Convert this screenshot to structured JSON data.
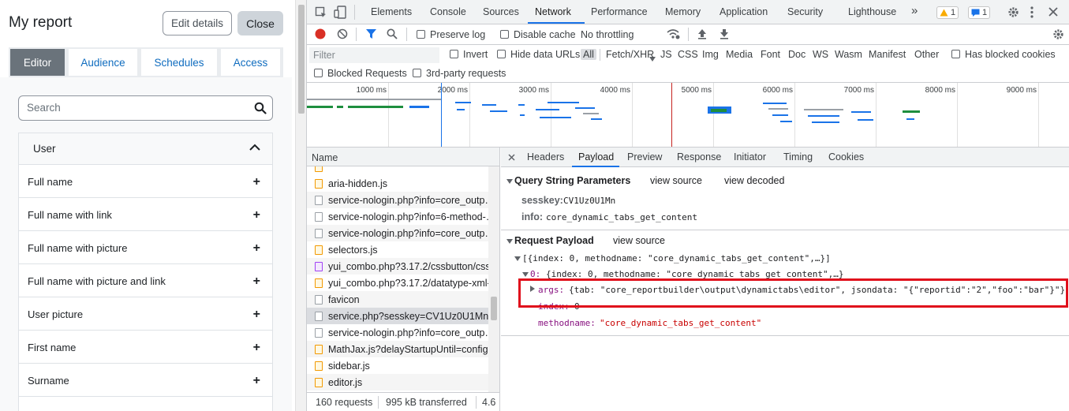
{
  "moodle": {
    "title": "My report",
    "edit_label": "Edit details",
    "close_label": "Close",
    "tabs": [
      "Editor",
      "Audience",
      "Schedules",
      "Access"
    ],
    "search_placeholder": "Search",
    "section_title": "User",
    "columns": [
      "Full name",
      "Full name with link",
      "Full name with picture",
      "Full name with picture and link",
      "User picture",
      "First name",
      "Surname"
    ],
    "plus": "+"
  },
  "devtools": {
    "tabs": [
      "Elements",
      "Console",
      "Sources",
      "Network",
      "Performance",
      "Memory",
      "Application",
      "Security",
      "Lighthouse"
    ],
    "more": "»",
    "warn_count": "1",
    "msg_count": "1",
    "toolbar": {
      "preserve_log": "Preserve log",
      "disable_cache": "Disable cache",
      "throttling": "No throttling"
    },
    "filter": {
      "placeholder": "Filter",
      "invert": "Invert",
      "hide_data_urls": "Hide data URLs",
      "types": [
        "All",
        "Fetch/XHR",
        "JS",
        "CSS",
        "Img",
        "Media",
        "Font",
        "Doc",
        "WS",
        "Wasm",
        "Manifest",
        "Other"
      ],
      "has_blocked_cookies": "Has blocked cookies",
      "blocked_requests": "Blocked Requests",
      "third_party": "3rd-party requests"
    },
    "timeline_labels": [
      "1000 ms",
      "2000 ms",
      "3000 ms",
      "4000 ms",
      "5000 ms",
      "6000 ms",
      "7000 ms",
      "8000 ms",
      "9000 ms"
    ],
    "name_header": "Name",
    "requests": [
      {
        "name": "aria-hidden.js",
        "type": "js"
      },
      {
        "name": "service-nologin.php?info=core_outp…",
        "type": "doc"
      },
      {
        "name": "service-nologin.php?info=6-method-…",
        "type": "doc"
      },
      {
        "name": "service-nologin.php?info=core_outp…",
        "type": "doc"
      },
      {
        "name": "selectors.js",
        "type": "js"
      },
      {
        "name": "yui_combo.php?3.17.2/cssbutton/css…",
        "type": "css"
      },
      {
        "name": "yui_combo.php?3.17.2/datatype-xml-…",
        "type": "js"
      },
      {
        "name": "favicon",
        "type": "doc"
      },
      {
        "name": "service.php?sesskey=CV1Uz0U1Mn&i…",
        "type": "doc"
      },
      {
        "name": "service-nologin.php?info=core_outp…",
        "type": "doc"
      },
      {
        "name": "MathJax.js?delayStartupUntil=config…",
        "type": "js"
      },
      {
        "name": "sidebar.js",
        "type": "js"
      },
      {
        "name": "editor.js",
        "type": "js"
      }
    ],
    "status": {
      "requests": "160 requests",
      "transferred": "995 kB transferred",
      "extra": "4.6"
    },
    "detail_tabs": [
      "Headers",
      "Payload",
      "Preview",
      "Response",
      "Initiator",
      "Timing",
      "Cookies"
    ],
    "query": {
      "title": "Query String Parameters",
      "view_source": "view source",
      "view_decoded": "view decoded",
      "sesskey_key": "sesskey:",
      "sesskey_val": "CV1Uz0U1Mn",
      "info_key": "info:",
      "info_val": "core_dynamic_tabs_get_content"
    },
    "payload": {
      "title": "Request Payload",
      "view_source": "view source",
      "line1": "[{index: 0, methodname: \"core_dynamic_tabs_get_content\",…}]",
      "line2_key": "0:",
      "line2_val": "{index: 0, methodname: \"core_dynamic_tabs_get_content\",…}",
      "args_key": "args:",
      "args_val": "{tab: \"core_reportbuilder\\output\\dynamictabs\\editor\", jsondata: \"{\"reportid\":\"2\",\"foo\":\"bar\"}\"}",
      "index_key": "index:",
      "index_val": "0",
      "methodname_key": "methodname:",
      "methodname_val": "\"core_dynamic_tabs_get_content\""
    },
    "colors": {
      "accent": "#1a73e8",
      "highlight": "#e0101c",
      "record": "#d93025"
    }
  }
}
